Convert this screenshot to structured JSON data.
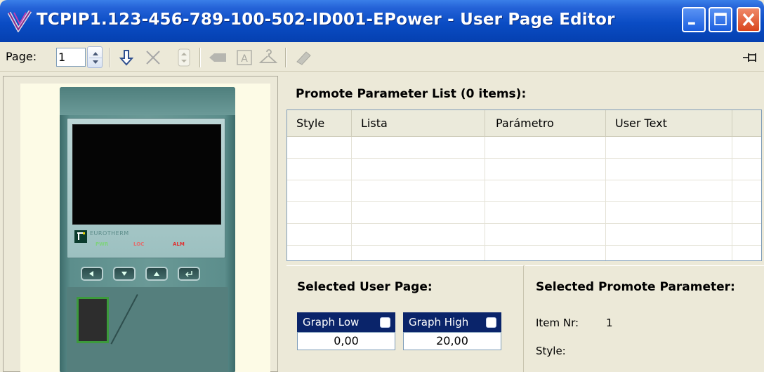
{
  "window": {
    "title": "TCPIP1.123-456-789-100-502-ID001-EPower - User Page Editor",
    "buttons": [
      "minimize",
      "maximize",
      "close"
    ]
  },
  "toolbar": {
    "page_label": "Page:",
    "page_value": "1",
    "icons": [
      "spin-updown-icon",
      "move-down-arrow-icon",
      "delete-x-icon",
      "spin-disabled-icon",
      "tag-icon",
      "text-a-icon",
      "hanger-icon",
      "eraser-icon",
      "pin-icon"
    ]
  },
  "device_preview": {
    "brand": "EUROTHERM",
    "leds": [
      "PWR",
      "LOC",
      "ALM"
    ],
    "led_colors": {
      "PWR": "#7fd27f",
      "LOC": "#e07070",
      "ALM": "#e03030"
    }
  },
  "promote_list": {
    "title": "Promote Parameter List (0 items):",
    "columns": [
      "Style",
      "Lista",
      "Parámetro",
      "User Text"
    ],
    "rows": []
  },
  "selected_user_page": {
    "title": "Selected User Page:",
    "graph_low_label": "Graph Low",
    "graph_low_value": "0,00",
    "graph_high_label": "Graph High",
    "graph_high_value": "20,00"
  },
  "selected_promote_parameter": {
    "title": "Selected Promote Parameter:",
    "item_nr_label": "Item Nr:",
    "item_nr_value": "1",
    "style_label": "Style:",
    "style_value": ""
  },
  "colors": {
    "titlebar": "#0a4cc4",
    "selection": "#0a246a",
    "window_bg": "#ece9d8"
  }
}
